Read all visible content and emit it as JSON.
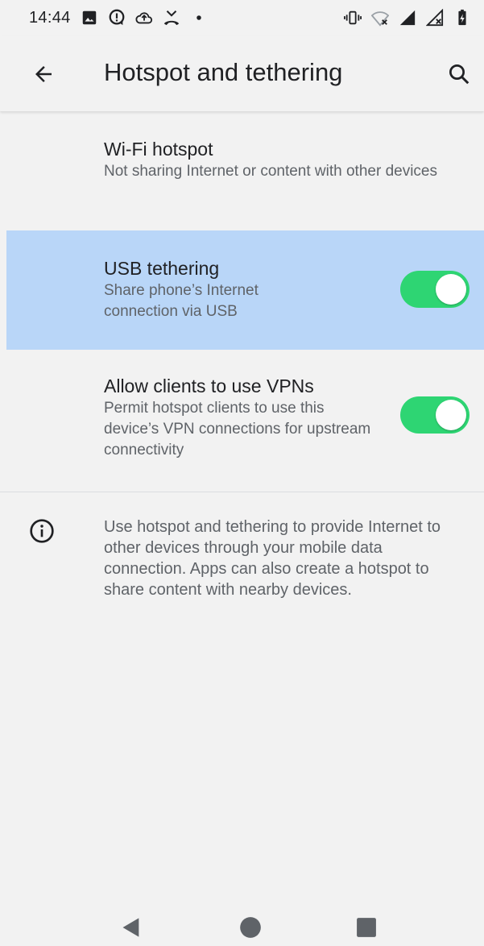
{
  "status_bar": {
    "time": "14:44",
    "left_icons": [
      "gallery-icon",
      "alert-icon",
      "cloud-upload-icon",
      "missed-call-icon",
      "dot-icon"
    ],
    "right_icons": [
      "vibrate-icon",
      "wifi-off-icon",
      "signal-icon",
      "signal-off-icon",
      "battery-icon"
    ]
  },
  "app_bar": {
    "title": "Hotspot and tethering",
    "back_icon": "arrow-back-icon",
    "search_icon": "search-icon"
  },
  "preferences": {
    "wifi_hotspot": {
      "title": "Wi-Fi hotspot",
      "summary": "Not sharing Internet or content with other devices"
    },
    "usb_tethering": {
      "title": "USB tethering",
      "summary": "Share phone’s Internet connection via USB",
      "enabled": true
    },
    "allow_vpn": {
      "title": "Allow clients to use VPNs",
      "summary": "Permit hotspot clients to use this device’s VPN connections for upstream connectivity",
      "enabled": true
    }
  },
  "footer": {
    "icon": "info-icon",
    "text": "Use hotspot and tethering to provide Internet to other devices through your mobile data connection. Apps can also create a hotspot to share content with nearby devices."
  },
  "nav_bar": {
    "buttons": [
      "back-triangle-icon",
      "home-circle-icon",
      "recents-square-icon"
    ]
  },
  "colors": {
    "background": "#f2f2f2",
    "highlight": "#b9d6f8",
    "switch_on": "#2ed573",
    "text_primary": "#202124",
    "text_secondary": "#5f6368"
  }
}
